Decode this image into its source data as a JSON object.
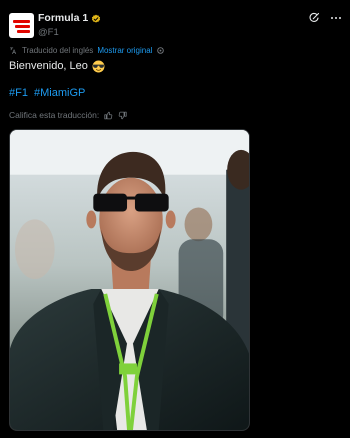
{
  "post": {
    "author_name": "Formula 1",
    "handle": "@F1",
    "translated_label": "Traducido del inglés",
    "show_original_label": "Mostrar original",
    "text": "Bienvenido, Leo",
    "hashtags": [
      "#F1",
      "#MiamiGP"
    ],
    "rate_translation_label": "Califica esta traducción:"
  },
  "icons": {
    "avatar": "formula1-logo-icon",
    "badge": "verified-gold-badge-icon",
    "grok": "grok-icon",
    "more": "more-dots-icon",
    "translate": "translate-icon",
    "settings": "gear-icon",
    "emoji": "sunglasses-emoji-icon",
    "thumbs_up": "thumbs-up-icon",
    "thumbs_down": "thumbs-down-icon"
  },
  "colors": {
    "background": "#000000",
    "text": "#e7e9ea",
    "secondary": "#71767b",
    "link": "#1d9bf0",
    "badge": "#e2b719",
    "brand": "#e10600"
  }
}
